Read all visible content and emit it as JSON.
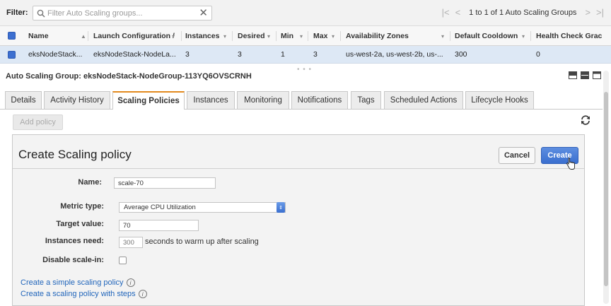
{
  "filter": {
    "label": "Filter:",
    "placeholder": "Filter Auto Scaling groups...",
    "clear_glyph": "✕"
  },
  "pager": {
    "first": "|<",
    "prev": "<",
    "text": "1 to 1 of 1 Auto Scaling Groups",
    "next": ">",
    "last": ">|"
  },
  "table": {
    "headers": [
      "Name",
      "Launch Configuration /",
      "Instances",
      "Desired",
      "Min",
      "Max",
      "Availability Zones",
      "Default Cooldown",
      "Health Check Grac"
    ],
    "rows": [
      [
        "eksNodeStack...",
        "eksNodeStack-NodeLa...",
        "3",
        "3",
        "1",
        "3",
        "us-west-2a, us-west-2b, us-...",
        "300",
        "0"
      ]
    ]
  },
  "group_title": "Auto Scaling Group: eksNodeStack-NodeGroup-113YQ6OVSCRNH",
  "tabs": [
    {
      "label": "Details",
      "active": false
    },
    {
      "label": "Activity History",
      "active": false
    },
    {
      "label": "Scaling Policies",
      "active": true
    },
    {
      "label": "Instances",
      "active": false
    },
    {
      "label": "Monitoring",
      "active": false
    },
    {
      "label": "Notifications",
      "active": false
    },
    {
      "label": "Tags",
      "active": false
    },
    {
      "label": "Scheduled Actions",
      "active": false
    },
    {
      "label": "Lifecycle Hooks",
      "active": false
    }
  ],
  "add_policy_label": "Add policy",
  "panel": {
    "title": "Create Scaling policy",
    "cancel_label": "Cancel",
    "create_label": "Create",
    "fields": {
      "name_label": "Name:",
      "name_value": "scale-70",
      "metric_label": "Metric type:",
      "metric_value": "Average CPU Utilization",
      "target_label": "Target value:",
      "target_value": "70",
      "instances_label": "Instances need:",
      "instances_placeholder": "300",
      "instances_suffix": "seconds to warm up after scaling",
      "disable_label": "Disable scale-in:",
      "disable_checked": false
    },
    "links": {
      "simple": "Create a simple scaling policy",
      "steps": "Create a scaling policy with steps"
    }
  },
  "colors": {
    "accent_blue": "#3a6fcf",
    "active_tab_border": "#e28a1e",
    "selected_row": "#dde8f5",
    "link": "#2266bb"
  }
}
